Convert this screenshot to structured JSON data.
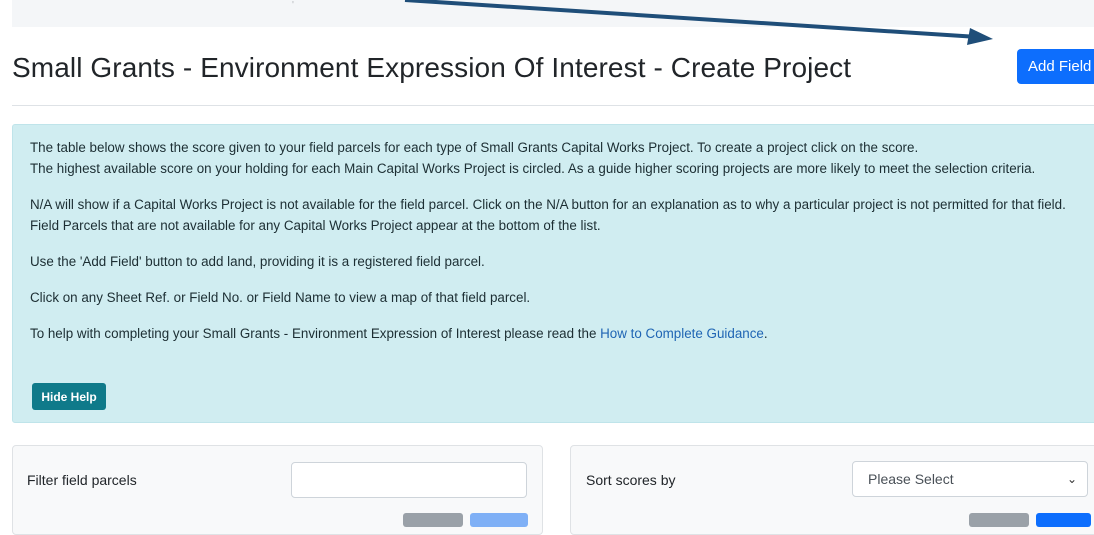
{
  "page": {
    "title": "Small Grants - Environment Expression Of Interest - Create Project",
    "add_field_label": "Add Field"
  },
  "help": {
    "line1": "The table below shows the score given to your field parcels for each type of Small Grants Capital Works Project. To create a project click on the score.",
    "line2": "The highest available score on your holding for each Main Capital Works Project is circled. As a guide higher scoring projects are more likely to meet the selection criteria.",
    "para2": "N/A will show if a Capital Works Project is not available for the field parcel. Click on the N/A button for an explanation as to why a particular project is not permitted for that field. Field Parcels that are not available for any Capital Works Project appear at the bottom of the list.",
    "para3": "Use the 'Add Field' button to add land, providing it is a registered field parcel.",
    "para4": "Click on any Sheet Ref. or Field No. or Field Name to view a map of that field parcel.",
    "para5_prefix": "To help with completing your Small Grants - Environment Expression of Interest please read the ",
    "para5_link": "How to Complete Guidance",
    "para5_suffix": ".",
    "hide_help_label": "Hide Help"
  },
  "filter": {
    "label": "Filter field parcels",
    "value": ""
  },
  "sort": {
    "label": "Sort scores by",
    "selected": "Please Select"
  },
  "colors": {
    "primary": "#0d6efd",
    "info_bg": "#d0edf1",
    "hide_help_bg": "#0f7a8a",
    "arrow": "#1f4e79"
  }
}
